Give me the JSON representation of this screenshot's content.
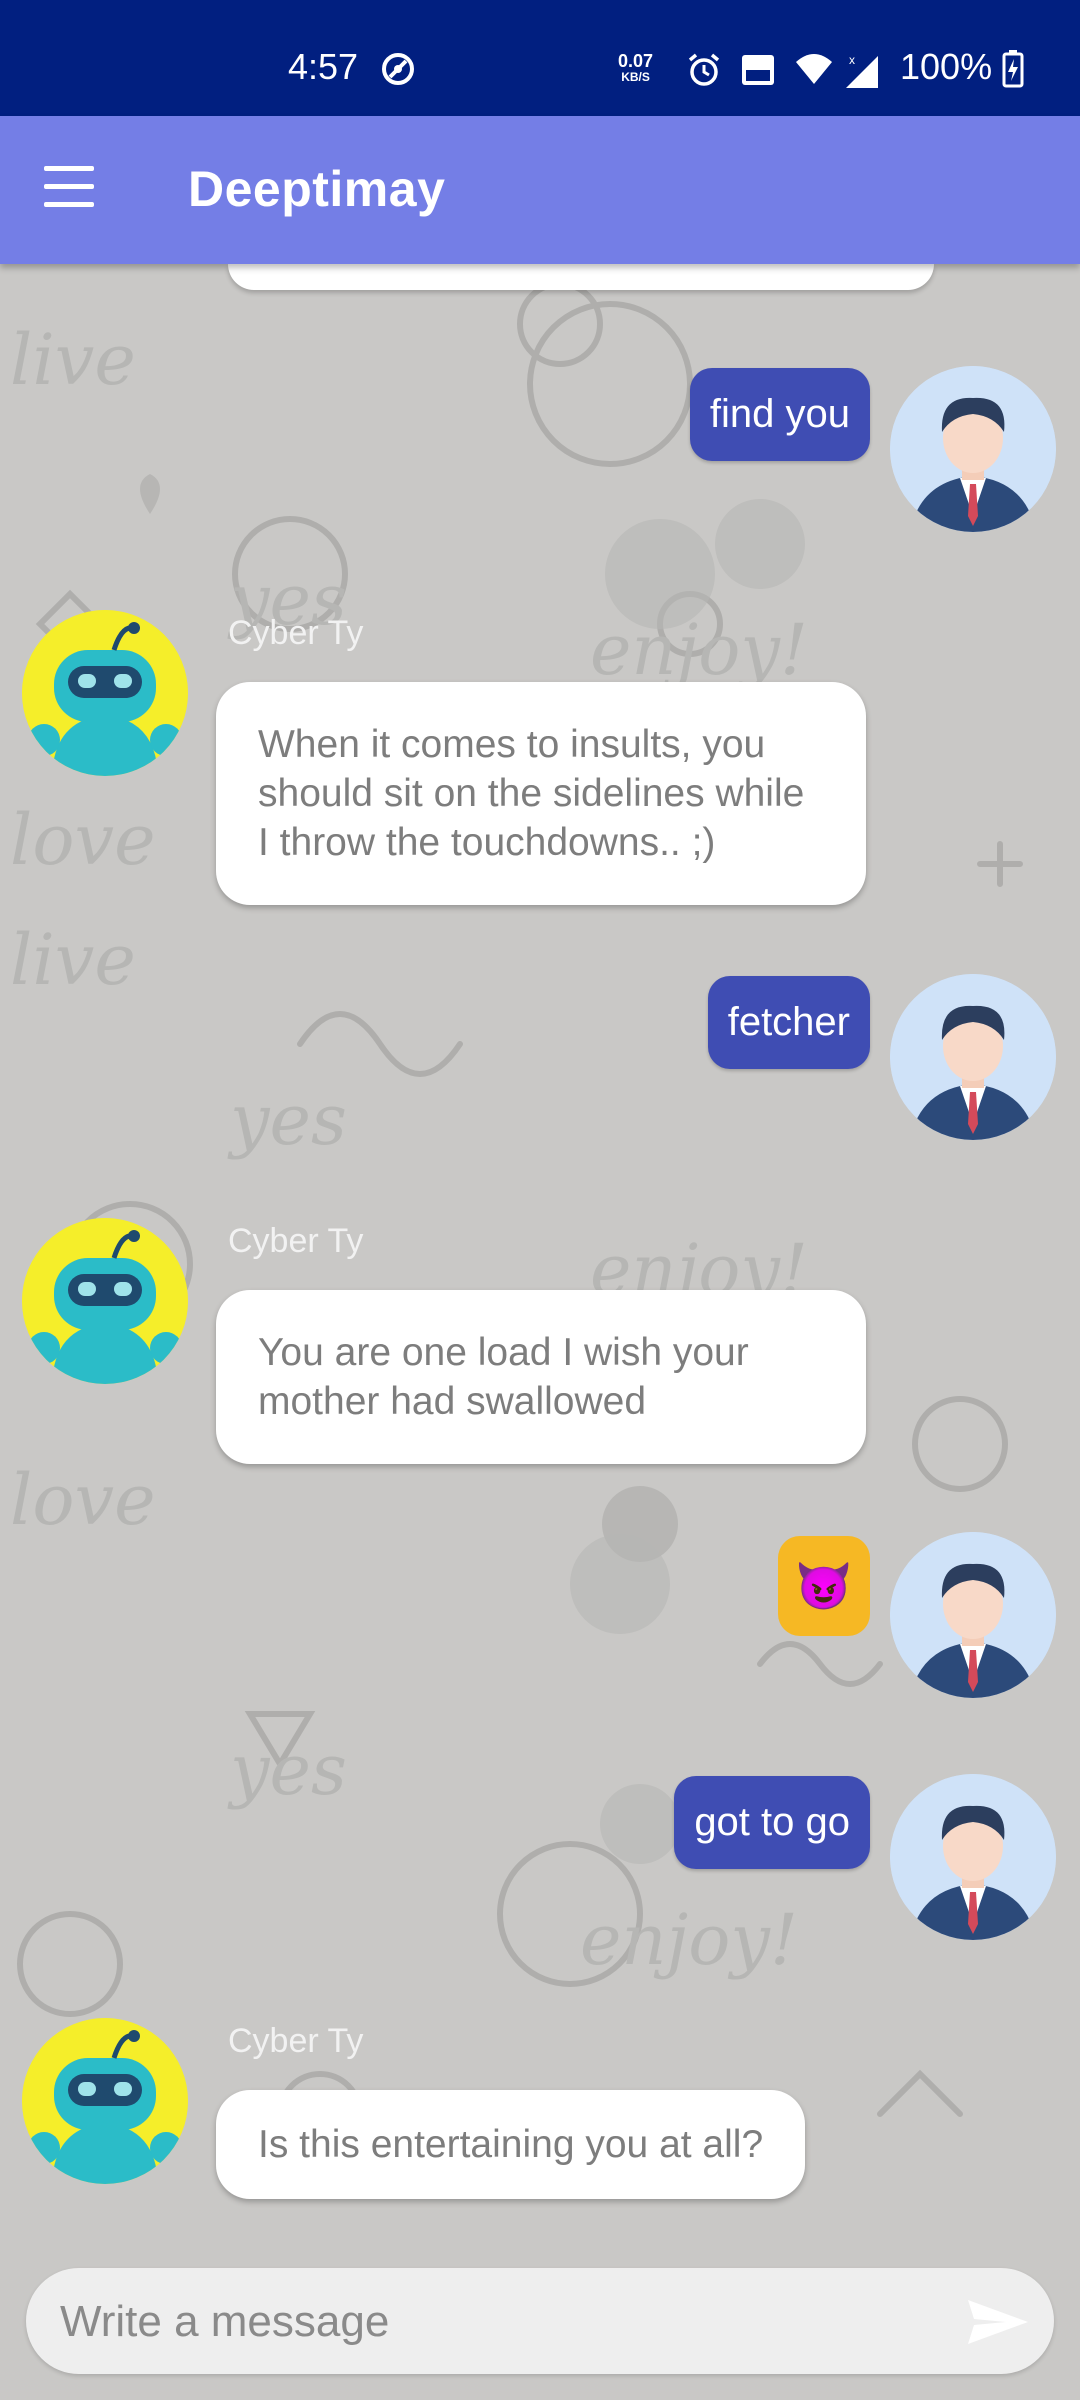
{
  "status_bar": {
    "time": "4:57",
    "net_speed": "0.07",
    "net_unit": "KB/S",
    "battery": "100%"
  },
  "app_bar": {
    "title": "Deeptimay"
  },
  "messages": [
    {
      "from": "user",
      "text": "find you"
    },
    {
      "from": "bot",
      "sender": "Cyber Ty",
      "text": "When it comes to insults, you should sit on the sidelines while I throw the touchdowns.. ;)"
    },
    {
      "from": "user",
      "text": "fetcher"
    },
    {
      "from": "bot",
      "sender": "Cyber Ty",
      "text": "You are one load I wish your mother had swallowed"
    },
    {
      "from": "user",
      "text": "😈"
    },
    {
      "from": "user",
      "text": "got to go"
    },
    {
      "from": "bot",
      "sender": "Cyber Ty",
      "text": "Is this entertaining you at all?"
    }
  ],
  "composer": {
    "placeholder": "Write a message"
  },
  "colors": {
    "status_bar": "#011f80",
    "app_bar": "#747ee6",
    "outgoing_bubble": "#3f4db3",
    "incoming_bubble": "#ffffff",
    "chat_background": "#c9c8c6"
  },
  "icons": [
    "menu-icon",
    "send-icon",
    "user-avatar",
    "bot-avatar",
    "wifi-icon",
    "signal-icon",
    "battery-icon",
    "alarm-icon",
    "volte-icon",
    "dnd-icon"
  ]
}
